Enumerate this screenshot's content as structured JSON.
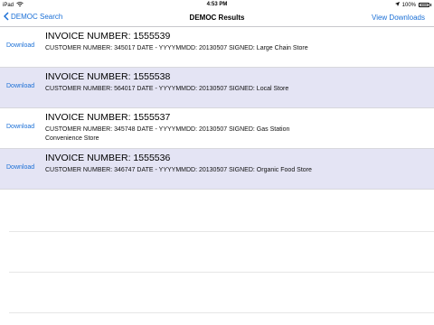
{
  "status_bar": {
    "device": "iPad",
    "time": "4:53 PM",
    "battery": "100%",
    "icons": [
      "wifi-icon",
      "location-arrow-icon",
      "battery-icon"
    ]
  },
  "nav": {
    "back_label": "DEMOC Search",
    "title": "DEMOC Results",
    "right_label": "View Downloads"
  },
  "results": [
    {
      "action": "Download",
      "invoice": "INVOICE NUMBER: 1555539",
      "details": "CUSTOMER NUMBER: 345017 DATE - YYYYMMDD: 20130507 SIGNED: Large Chain Store"
    },
    {
      "action": "Download",
      "invoice": "INVOICE NUMBER: 1555538",
      "details": "CUSTOMER NUMBER: 564017 DATE - YYYYMMDD: 20130507 SIGNED: Local Store"
    },
    {
      "action": "Download",
      "invoice": "INVOICE NUMBER: 1555537",
      "details": "CUSTOMER NUMBER: 345748 DATE - YYYYMMDD: 20130507 SIGNED: Gas Station Convenience Store"
    },
    {
      "action": "Download",
      "invoice": "INVOICE NUMBER: 1555536",
      "details": "CUSTOMER NUMBER: 346747 DATE - YYYYMMDD: 20130507 SIGNED: Organic Food Store"
    }
  ],
  "colors": {
    "accent": "#1a6fd6",
    "alt_row": "#e4e4f4",
    "separator": "#d8d8dd"
  }
}
